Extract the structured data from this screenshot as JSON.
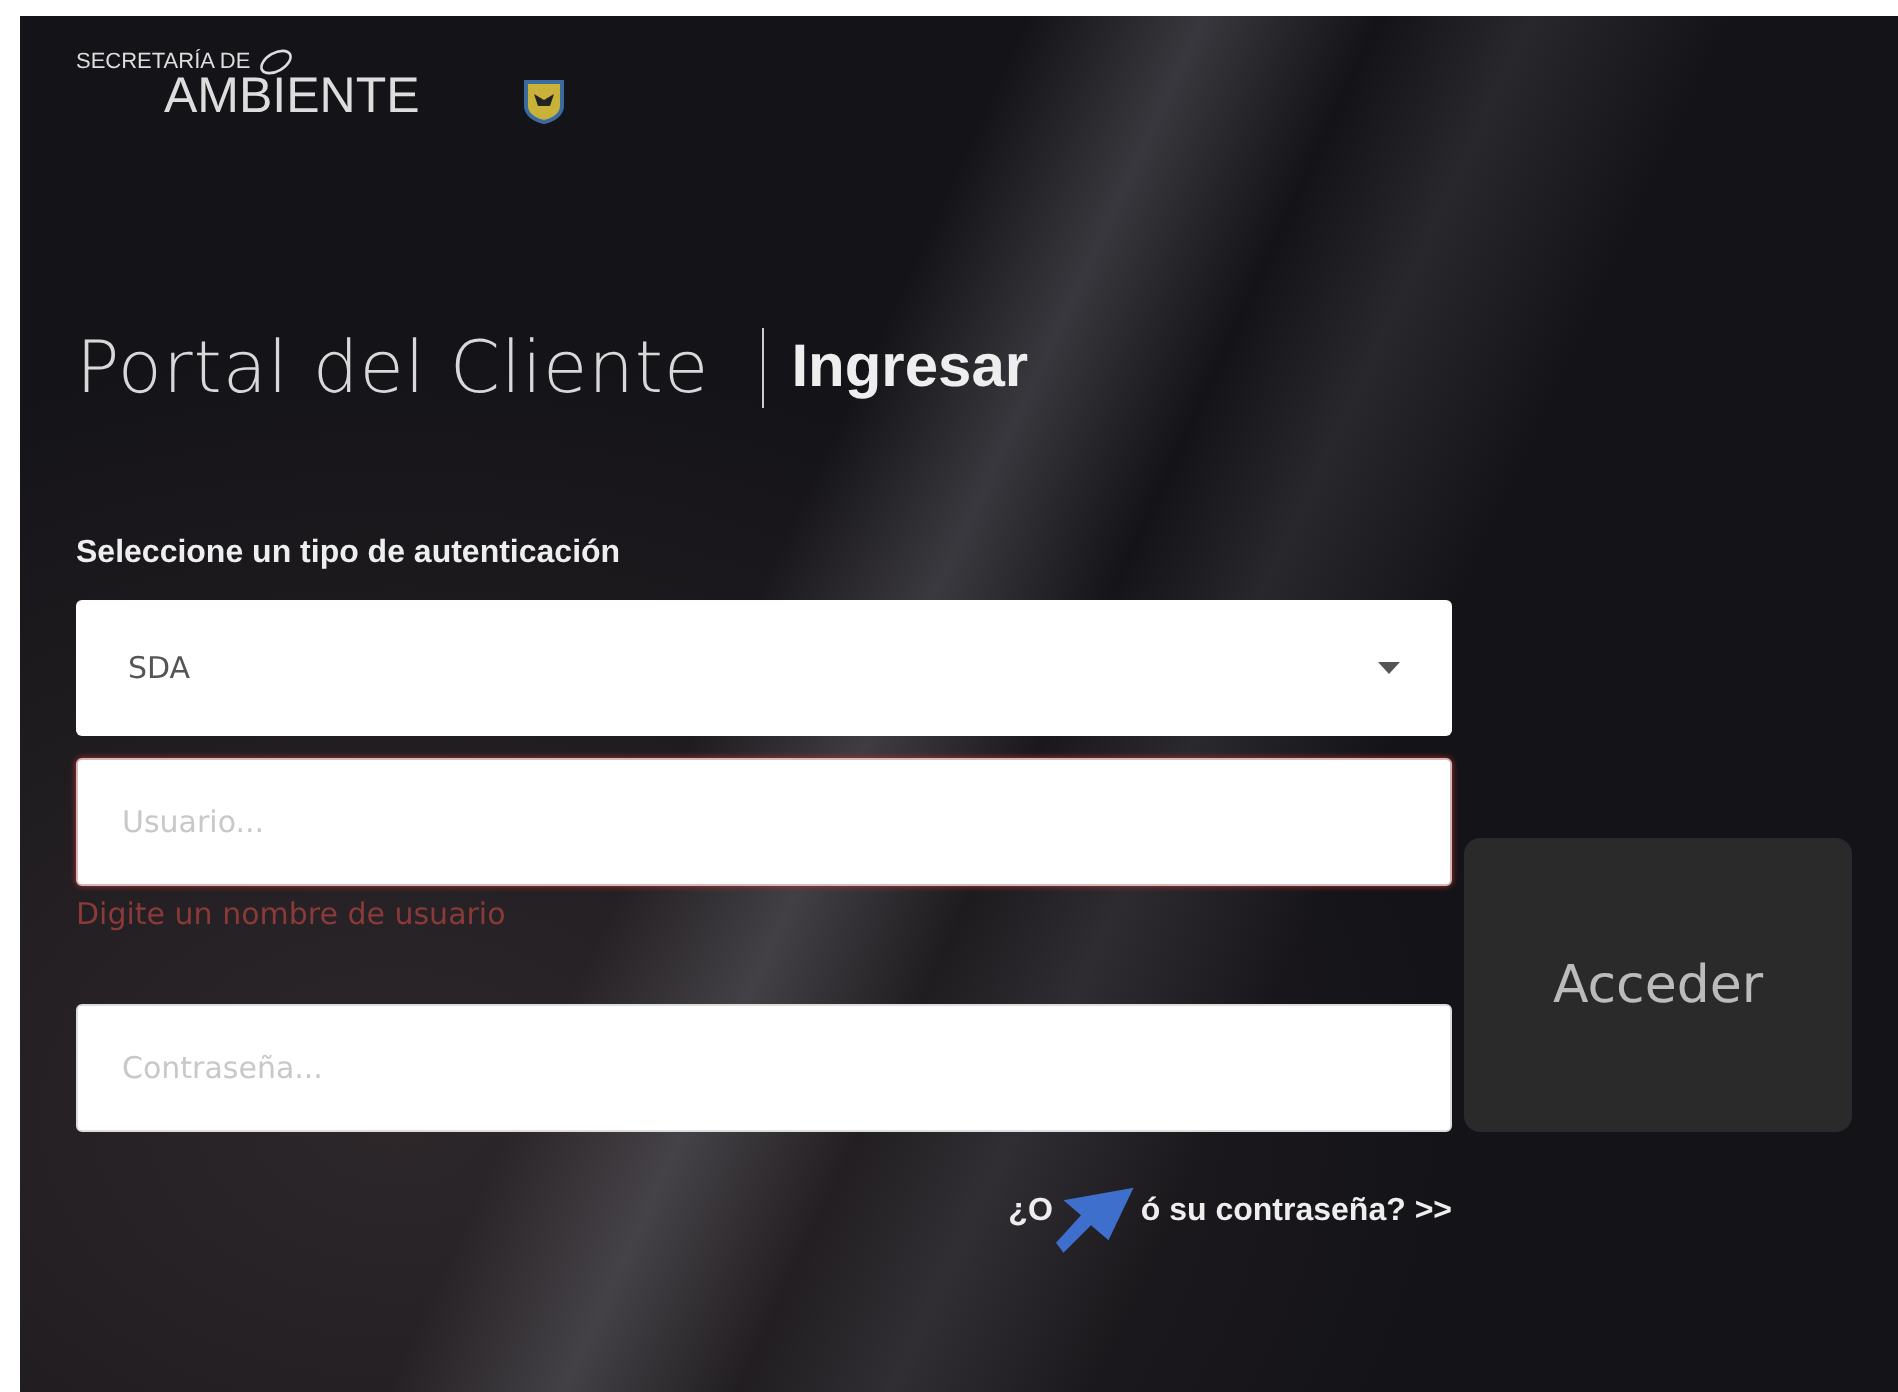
{
  "logo": {
    "line_1": "SECRETARÍA DE",
    "line_2": "AMBIENTE"
  },
  "heading": {
    "title": "Portal del Cliente",
    "action": "Ingresar"
  },
  "auth_select": {
    "label": "Seleccione un tipo de autenticación",
    "value": "SDA"
  },
  "username": {
    "placeholder": "Usuario...",
    "invalid": true,
    "error": "Digite un nombre de usuario"
  },
  "password": {
    "placeholder": "Contraseña..."
  },
  "submit_button": "Acceder",
  "forgot_link": {
    "text_before_cursor": "¿O",
    "text_after_cursor": "ó su contraseña? >>"
  }
}
